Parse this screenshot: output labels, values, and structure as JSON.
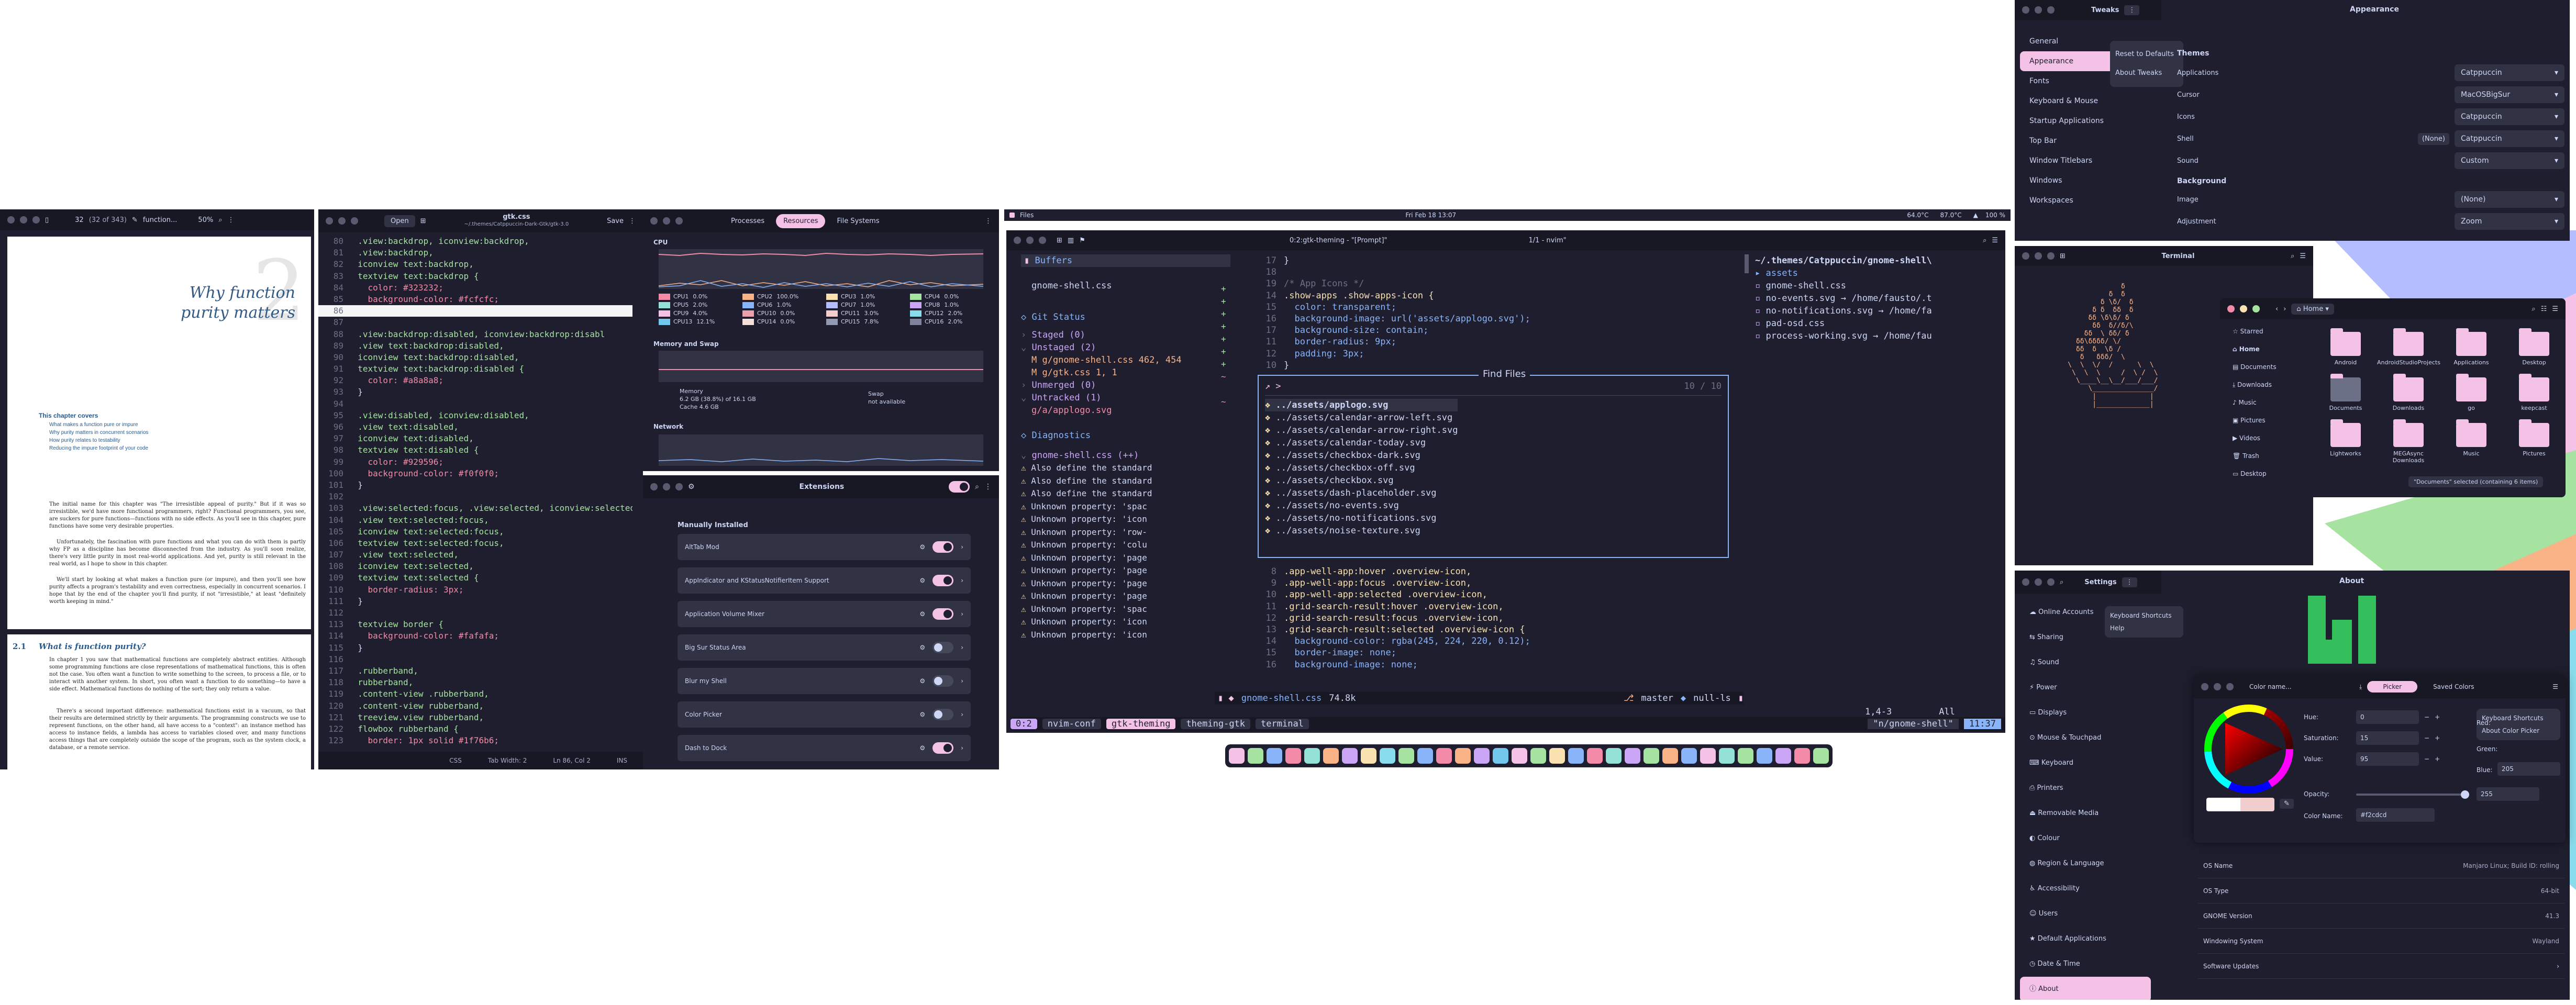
{
  "pdf": {
    "page": "32",
    "total": "(32 of 343)",
    "search": "function...",
    "zoom": "50%",
    "chapter_num": "2",
    "title1": "Why function",
    "title2": "purity matters",
    "covers_title": "This chapter covers",
    "bullets": [
      "What makes a function pure or impure",
      "Why purity matters in concurrent scenarios",
      "How purity relates to testability",
      "Reducing the impure footprint of your code"
    ],
    "para1": "The initial name for this chapter was \"The irresistible appeal of purity.\" But if it was so irresistible, we'd have more functional programmers, right? Functional programmers, you see, are suckers for pure functions—functions with no side effects. As you'll see in this chapter, pure functions have some very desirable properties.",
    "para2": "Unfortunately, the fascination with pure functions and what you can do with them is partly why FP as a discipline has become disconnected from the industry. As you'll soon realize, there's very little purity in most real-world applications. And yet, purity is still relevant in the real world, as I hope to show in this chapter.",
    "para3": "We'll start by looking at what makes a function pure (or impure), and then you'll see how purity affects a program's testability and even correctness, especially in concurrent scenarios. I hope that by the end of the chapter you'll find purity, if not \"irresistible,\" at least \"definitely worth keeping in mind.\"",
    "sec_num": "2.1",
    "sec_title": "What is function purity?",
    "para4": "In chapter 1 you saw that mathematical functions are completely abstract entities. Although some programming functions are close representations of mathematical functions, this is often not the case. You often want a function to write something to the screen, to process a file, or to interact with another system. In short, you often want a function to do something—to have a side effect. Mathematical functions do nothing of the sort; they only return a value.",
    "para5": "There's a second important difference: mathematical functions exist in a vacuum, so that their results are determined strictly by their arguments. The programming constructs we use to represent functions, on the other hand, all have access to a \"context\": an instance method has access to instance fields, a lambda has access to variables closed over, and many functions access things that are completely outside the scope of the program, such as the system clock, a database, or a remote service."
  },
  "gedit": {
    "title": "gtk.css",
    "path": "~/.themes/Catppuccin-Dark-Gtk/gtk-3.0",
    "open": "Open",
    "save": "Save",
    "status": [
      "CSS",
      "Tab Width: 2",
      "Ln 86, Col 2",
      "INS"
    ],
    "lines": [
      [
        "80",
        "  .view:backdrop, iconview:backdrop,",
        "green"
      ],
      [
        "81",
        "  .view:backdrop,",
        "green"
      ],
      [
        "82",
        "  iconview text:backdrop,",
        "green"
      ],
      [
        "83",
        "  textview text:backdrop {",
        "green"
      ],
      [
        "84",
        "    color: #323232;",
        "red"
      ],
      [
        "85",
        "    background-color: #fcfcfc;",
        "red"
      ],
      [
        "86",
        "",
        "cur"
      ],
      [
        "87",
        "",
        "txt"
      ],
      [
        "88",
        "  .view:backdrop:disabled, iconview:backdrop:disabl",
        "green"
      ],
      [
        "89",
        "  .view text:backdrop:disabled,",
        "green"
      ],
      [
        "90",
        "  iconview text:backdrop:disabled,",
        "green"
      ],
      [
        "91",
        "  textview text:backdrop:disabled {",
        "green"
      ],
      [
        "92",
        "    color: #a8a8a8;",
        "red"
      ],
      [
        "93",
        "  }",
        "txt"
      ],
      [
        "94",
        "",
        "txt"
      ],
      [
        "95",
        "  .view:disabled, iconview:disabled,",
        "green"
      ],
      [
        "96",
        "  .view text:disabled,",
        "green"
      ],
      [
        "97",
        "  iconview text:disabled,",
        "green"
      ],
      [
        "98",
        "  textview text:disabled {",
        "green"
      ],
      [
        "99",
        "    color: #929596;",
        "red"
      ],
      [
        "100",
        "    background-color: #f0f0f0;",
        "red"
      ],
      [
        "101",
        "  }",
        "txt"
      ],
      [
        "102",
        "",
        "txt"
      ],
      [
        "103",
        "  .view:selected:focus, .view:selected, iconview:selected:focus,",
        "green"
      ],
      [
        "104",
        "  .view text:selected:focus,",
        "green"
      ],
      [
        "105",
        "  iconview text:selected:focus,",
        "green"
      ],
      [
        "106",
        "  textview text:selected:focus,",
        "green"
      ],
      [
        "107",
        "  .view text:selected,",
        "green"
      ],
      [
        "108",
        "  iconview text:selected,",
        "green"
      ],
      [
        "109",
        "  textview text:selected {",
        "green"
      ],
      [
        "110",
        "    border-radius: 3px;",
        "red"
      ],
      [
        "111",
        "  }",
        "txt"
      ],
      [
        "112",
        "",
        "txt"
      ],
      [
        "113",
        "  textview border {",
        "green"
      ],
      [
        "114",
        "    background-color: #fafafa;",
        "red"
      ],
      [
        "115",
        "  }",
        "txt"
      ],
      [
        "116",
        "",
        "txt"
      ],
      [
        "117",
        "  .rubberband,",
        "green"
      ],
      [
        "118",
        "  rubberband,",
        "green"
      ],
      [
        "119",
        "  .content-view .rubberband,",
        "green"
      ],
      [
        "120",
        "  .content-view rubberband,",
        "green"
      ],
      [
        "121",
        "  treeview.view rubberband,",
        "green"
      ],
      [
        "122",
        "  flowbox rubberband {",
        "green"
      ],
      [
        "123",
        "    border: 1px solid #1f76b6;",
        "red"
      ]
    ]
  },
  "monitor": {
    "tabs": [
      "Processes",
      "Resources",
      "File Systems"
    ],
    "cpu": "CPU",
    "cpus": [
      [
        "CPU1",
        "0.0%"
      ],
      [
        "CPU2",
        "100.0%"
      ],
      [
        "CPU3",
        "1.0%"
      ],
      [
        "CPU4",
        "0.0%"
      ],
      [
        "CPU5",
        "2.0%"
      ],
      [
        "CPU6",
        "1.0%"
      ],
      [
        "CPU7",
        "1.0%"
      ],
      [
        "CPU8",
        "1.0%"
      ],
      [
        "CPU9",
        "4.0%"
      ],
      [
        "CPU10",
        "0.0%"
      ],
      [
        "CPU11",
        "3.0%"
      ],
      [
        "CPU12",
        "2.0%"
      ],
      [
        "CPU13",
        "12.1%"
      ],
      [
        "CPU14",
        "0.0%"
      ],
      [
        "CPU15",
        "7.8%"
      ],
      [
        "CPU16",
        "2.0%"
      ]
    ],
    "mem": "Memory and Swap",
    "mem_label": "Memory",
    "mem_val": "6.2 GB (38.8%) of 16.1 GB",
    "cache": "Cache 4.6 GB",
    "swap": "Swap",
    "swap_val": "not available",
    "net": "Network"
  },
  "ext": {
    "title": "Extensions",
    "section": "Manually Installed",
    "items": [
      [
        "AltTab Mod",
        true
      ],
      [
        "AppIndicator and KStatusNotifierItem Support",
        true
      ],
      [
        "Application Volume Mixer",
        true
      ],
      [
        "Big Sur Status Area",
        false
      ],
      [
        "Blur my Shell",
        false
      ],
      [
        "Color Picker",
        false
      ],
      [
        "Dash to Dock",
        true
      ]
    ]
  },
  "topbar": {
    "files": "Files",
    "clock": "Fri Feb 18  13:07",
    "temp1": "64.0°C",
    "temp2": "87.0°C",
    "battery": "100 %"
  },
  "nvim": {
    "title": "0:2:gtk-theming - \"[Prompt]\"",
    "title2": "1/1 - nvim\"",
    "buffers": "Buffers",
    "buf1": "gnome-shell.css",
    "git": "Git Status",
    "staged": "Staged (0)",
    "unstaged": "Unstaged (2)",
    "u1": "M g/gnome-shell.css 462, 454",
    "u2": "M g/gtk.css 1, 1",
    "unmerged": "Unmerged (0)",
    "untracked": "Untracked (1)",
    "t1": "g/a/applogo.svg",
    "diag": "Diagnostics",
    "d0": "gnome-shell.css (++)",
    "diags": [
      "Also define the standard",
      "Also define the standard",
      "Also define the standard",
      "Unknown property: 'spac",
      "Unknown property: 'icon",
      "Unknown property: 'row-",
      "Unknown property: 'colu",
      "Unknown property: 'page",
      "Unknown property: 'page",
      "Unknown property: 'page",
      "Unknown property: 'page",
      "Unknown property: 'spac",
      "Unknown property: 'icon",
      "Unknown property: 'icon"
    ],
    "code": [
      [
        "17",
        "}",
        "txt"
      ],
      [
        "18",
        "",
        "txt"
      ],
      [
        "19",
        "/* App Icons */",
        "dim"
      ],
      [
        "14",
        ".show-apps .show-apps-icon {",
        "yel"
      ],
      [
        "15",
        "  color: transparent;",
        "blue"
      ],
      [
        "16",
        "  background-image: url('assets/applogo.svg');",
        "blue"
      ],
      [
        "17",
        "  background-size: contain;",
        "blue"
      ],
      [
        "11",
        "  border-radius: 9px;",
        "blue"
      ],
      [
        "12",
        "  padding: 3px;",
        "blue"
      ],
      [
        "10",
        "}",
        "txt"
      ]
    ],
    "code2": [
      [
        "8",
        ".app-well-app:hover .overview-icon,",
        "yel"
      ],
      [
        "9",
        ".app-well-app:focus .overview-icon,",
        "yel"
      ],
      [
        "10",
        ".app-well-app:selected .overview-icon,",
        "yel"
      ],
      [
        "11",
        ".grid-search-result:hover .overview-icon,",
        "yel"
      ],
      [
        "12",
        ".grid-search-result:focus .overview-icon,",
        "yel"
      ],
      [
        "13",
        ".grid-search-result:selected .overview-icon {",
        "yel"
      ],
      [
        "14",
        "  background-color: rgba(245, 224, 220, 0.12);",
        "blue"
      ],
      [
        "15",
        "  border-image: none;",
        "blue"
      ],
      [
        "16",
        "  background-image: none;",
        "blue"
      ]
    ],
    "find_title": "Find Files",
    "find_count": "10 / 10",
    "find_prompt": ">",
    "find_items": [
      "../assets/applogo.svg",
      "../assets/calendar-arrow-left.svg",
      "../assets/calendar-arrow-right.svg",
      "../assets/calendar-today.svg",
      "../assets/checkbox-dark.svg",
      "../assets/checkbox-off.svg",
      "../assets/checkbox.svg",
      "../assets/dash-placeholder.svg",
      "../assets/no-events.svg",
      "../assets/no-notifications.svg",
      "../assets/noise-texture.svg"
    ],
    "tree_root": "~/.themes/Catppuccin/gnome-shell\\",
    "tree": [
      "assets",
      "gnome-shell.css",
      "no-events.svg → /home/fausto/.t",
      "no-notifications.svg → /home/fa",
      "pad-osd.css",
      "process-working.svg → /home/fau"
    ],
    "status_file": "gnome-shell.css",
    "status_size": "74.8k",
    "status_branch": "master",
    "status_null": "null-ls",
    "status_pos": "1,4-3",
    "status_all": "All",
    "tmux": [
      "0:2",
      "nvim-conf",
      "gtk-theming",
      "theming-gtk",
      "terminal"
    ],
    "tmux_right": "\"n/gnome-shell\"",
    "tmux_time": "11:37"
  },
  "tweaks": {
    "title": "Tweaks",
    "title2": "Appearance",
    "sidebar": [
      "General",
      "Appearance",
      "Fonts",
      "Keyboard & Mouse",
      "Startup Applications",
      "Top Bar",
      "Window Titlebars",
      "Windows",
      "Workspaces"
    ],
    "menu": [
      "Reset to Defaults",
      "About Tweaks"
    ],
    "themes_hdr": "Themes",
    "rows": [
      [
        "Applications",
        "Catppuccin"
      ],
      [
        "Cursor",
        "MacOSBigSur"
      ],
      [
        "Icons",
        "Catppuccin"
      ],
      [
        "Shell",
        "Catppuccin"
      ],
      [
        "Sound",
        "Custom"
      ]
    ],
    "bg_hdr": "Background",
    "bg_rows": [
      [
        "Image",
        "(None)"
      ],
      [
        "Adjustment",
        "Zoom"
      ]
    ],
    "shell_none": "(None)"
  },
  "terminal": {
    "title": "Terminal"
  },
  "nautilus": {
    "title": "Home",
    "places": [
      "Starred",
      "Home",
      "Documents",
      "Downloads",
      "Music",
      "Pictures",
      "Videos",
      "Trash",
      "Desktop"
    ],
    "files": [
      "Android",
      "AndroidStudioProjects",
      "Applications",
      "Desktop",
      "Documents",
      "Downloads",
      "go",
      "keepcast",
      "Lightworks",
      "MEGAsync Downloads",
      "Music",
      "Pictures"
    ],
    "tooltip": "\"Documents\" selected (containing 6 items)"
  },
  "settings": {
    "title": "Settings",
    "title2": "About",
    "sidebar": [
      "Online Accounts",
      "Sharing",
      "Sound",
      "Power",
      "Displays",
      "Mouse & Touchpad",
      "Keyboard",
      "Printers",
      "Removable Media",
      "Colour",
      "Region & Language",
      "Accessibility",
      "Users",
      "Default Applications",
      "Date & Time",
      "About"
    ],
    "menu": [
      "Keyboard Shortcuts",
      "Help"
    ],
    "info": [
      [
        "OS Name",
        "Manjaro Linux; Build ID: rolling"
      ],
      [
        "OS Type",
        "64-bit"
      ],
      [
        "GNOME Version",
        "41.3"
      ],
      [
        "Windowing System",
        "Wayland"
      ],
      [
        "Software Updates",
        ""
      ]
    ]
  },
  "picker": {
    "title": "Color name...",
    "tabs": [
      "Picker",
      "Saved Colors"
    ],
    "menu": [
      "Keyboard Shortcuts",
      "About Color Picker"
    ],
    "fields": [
      [
        "Hue:",
        "0"
      ],
      [
        "Saturation:",
        "15"
      ],
      [
        "Value:",
        "95"
      ]
    ],
    "opacity": "Opacity:",
    "op_val": "255",
    "red": "Red:",
    "green": "Green:",
    "blue": "Blue:",
    "blue_val": "205",
    "name_lbl": "Color Name:",
    "name_val": "#f2cdcd"
  },
  "colors": {
    "base": "#1e1e2e",
    "mantle": "#181825",
    "pink": "#f5c2e7",
    "flamingo": "#f2cdcd",
    "mauve": "#cba6f7",
    "blue": "#89b4fa",
    "green": "#a6e3a1",
    "peach": "#fab387",
    "teal": "#94e2d5",
    "red": "#f38ba8",
    "yellow": "#f9e2af"
  }
}
